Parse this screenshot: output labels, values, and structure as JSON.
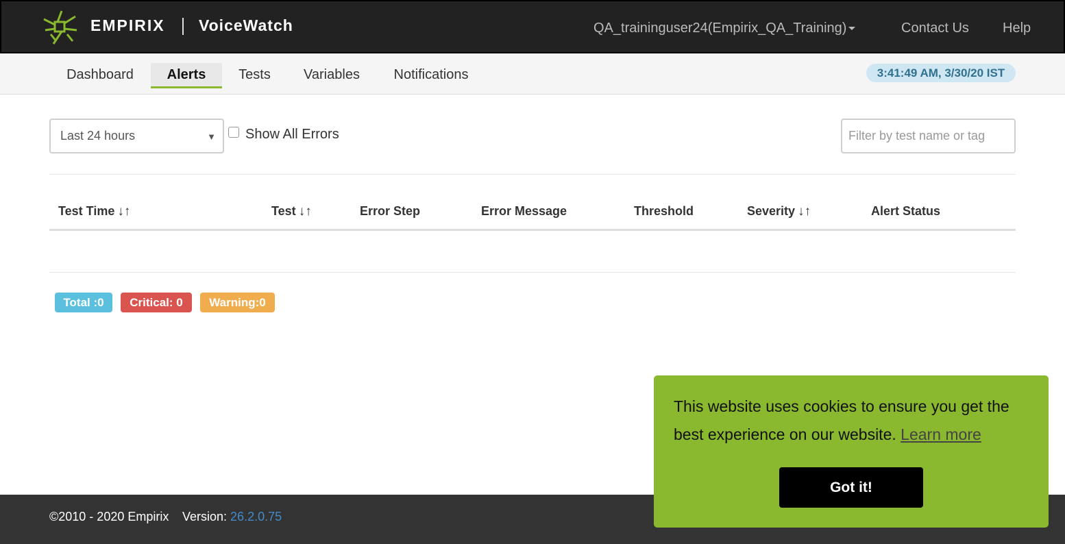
{
  "header": {
    "brand": "EMPIRIX",
    "product": "VoiceWatch",
    "user": "QA_traininguser24(Empirix_QA_Training)",
    "contact": "Contact Us",
    "help": "Help"
  },
  "nav": {
    "tabs": [
      {
        "label": "Dashboard"
      },
      {
        "label": "Alerts"
      },
      {
        "label": "Tests"
      },
      {
        "label": "Variables"
      },
      {
        "label": "Notifications"
      }
    ],
    "active_tab": "Alerts",
    "clock": "3:41:49 AM, 3/30/20 IST"
  },
  "filters": {
    "time_range": "Last 24 hours",
    "show_all_errors": "Show All Errors",
    "search_placeholder": "Filter by test name or tag"
  },
  "table": {
    "columns": [
      {
        "label": "Test Time",
        "sort": "↓↑"
      },
      {
        "label": "Test",
        "sort": "↓↑"
      },
      {
        "label": "Error Step"
      },
      {
        "label": "Error Message"
      },
      {
        "label": "Threshold"
      },
      {
        "label": "Severity",
        "sort": "↓↑"
      },
      {
        "label": "Alert Status"
      }
    ],
    "rows": []
  },
  "summary": {
    "total": "Total :0",
    "critical": "Critical: 0",
    "warning": "Warning:0"
  },
  "footer": {
    "copyright": "©2010 - 2020 Empirix",
    "version_label": "Version: ",
    "version_value": "26.2.0.75"
  },
  "cookie": {
    "message": "This website uses cookies to ensure you get the best experience on our website.",
    "link": "Learn more",
    "button": "Got it!"
  },
  "colors": {
    "accent_green": "#8ab82e",
    "info": "#5bc0de",
    "danger": "#d9534f",
    "warning": "#f0ad4e"
  }
}
